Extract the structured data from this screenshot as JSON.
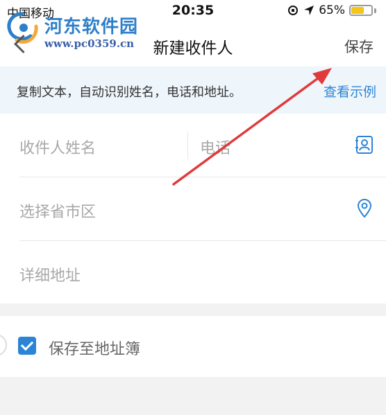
{
  "status_bar": {
    "carrier": "中国移动",
    "time": "20:35",
    "battery": "65%",
    "battery_level": 0.65
  },
  "watermark": {
    "title": "河东软件园",
    "url": "www.pc0359.cn"
  },
  "nav": {
    "title": "新建收件人",
    "save_label": "保存"
  },
  "banner": {
    "text": "复制文本，自动识别姓名，电话和地址。",
    "link": "查看示例"
  },
  "form": {
    "name_placeholder": "收件人姓名",
    "phone_placeholder": "电话",
    "region_placeholder": "选择省市区",
    "address_placeholder": "详细地址"
  },
  "save_to_book": {
    "label": "保存至地址簿",
    "checked": true
  },
  "colors": {
    "accent": "#2c84d6",
    "banner_bg": "#eef5fb",
    "annotation_arrow": "#e03a3a"
  }
}
